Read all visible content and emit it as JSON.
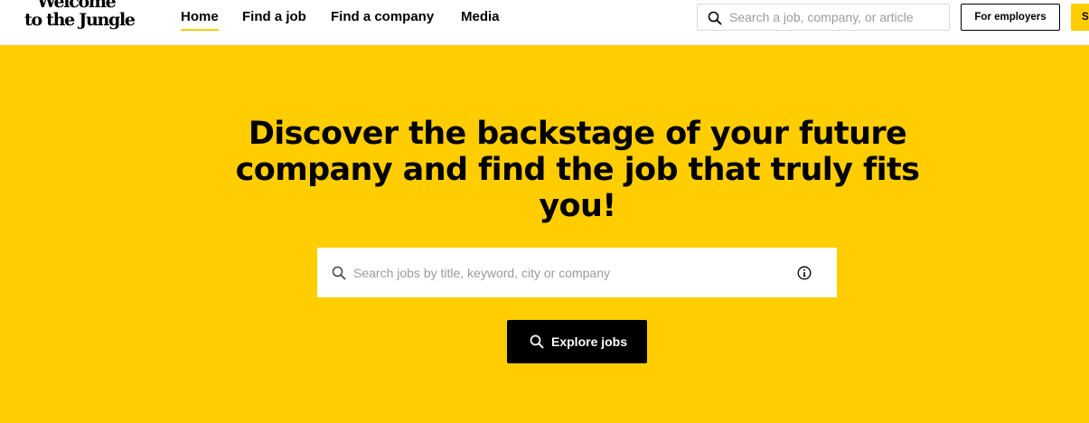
{
  "brand": {
    "logo_line1": "Welcome",
    "logo_line2": "to the Jungle"
  },
  "nav": {
    "items": [
      {
        "label": "Home",
        "active": true
      },
      {
        "label": "Find a job",
        "active": false
      },
      {
        "label": "Find a company",
        "active": false
      },
      {
        "label": "Media",
        "active": false
      }
    ]
  },
  "header_search": {
    "placeholder": "Search a job, company, or article",
    "icon": "search-icon"
  },
  "header_actions": {
    "employers_label": "For employers",
    "signin_label": "Sign in"
  },
  "hero": {
    "title": "Discover the backstage of your future company and find the job that truly fits you!",
    "search_placeholder": "Search jobs by title, keyword, city or company",
    "search_icon": "search-icon",
    "info_icon": "info-icon",
    "cta_label": "Explore jobs",
    "cta_icon": "search-icon"
  },
  "colors": {
    "brand_yellow": "#ffcd00",
    "text_dark": "#000000",
    "header_bg": "#ffffff"
  }
}
